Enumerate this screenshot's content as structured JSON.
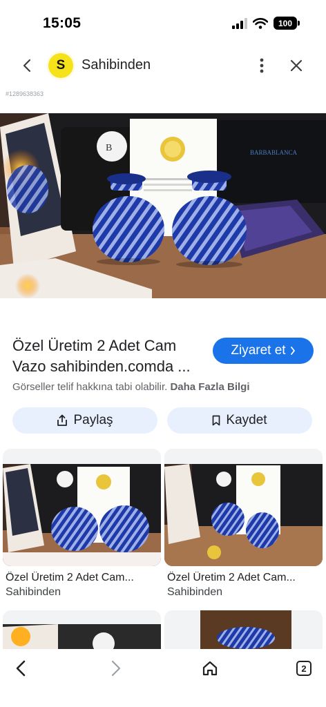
{
  "status_bar": {
    "time": "15:05",
    "battery": "100"
  },
  "header": {
    "logo_letter": "S",
    "site_name": "Sahibinden"
  },
  "image_id": "#1289638363",
  "photo_text": {
    "brand": "BARBABLANCA",
    "box_label": "BARBABLANCA"
  },
  "result": {
    "title": "Özel Üretim 2 Adet Cam Vazo sahibinden.comda ...",
    "visit_label": "Ziyaret et",
    "copyright": "Görseller telif hakkına tabi olabilir.",
    "more_info": "Daha Fazla Bilgi"
  },
  "actions": {
    "share_label": "Paylaş",
    "save_label": "Kaydet"
  },
  "related": [
    {
      "title": "Özel Üretim 2 Adet Cam...",
      "source": "Sahibinden"
    },
    {
      "title": "Özel Üretim 2 Adet Cam...",
      "source": "Sahibinden"
    }
  ],
  "bottom_nav": {
    "tabs_count": "2"
  },
  "colors": {
    "accent": "#1a73e8",
    "chip": "#e8f0fe",
    "logo": "#f5e21b",
    "vase": "#1e3aa8"
  },
  "icons": {
    "back": "chevron-left-icon",
    "more": "more-vertical-icon",
    "close": "close-icon",
    "share": "share-icon",
    "save": "bookmark-icon",
    "home": "home-icon",
    "tabs": "tabs-icon"
  }
}
